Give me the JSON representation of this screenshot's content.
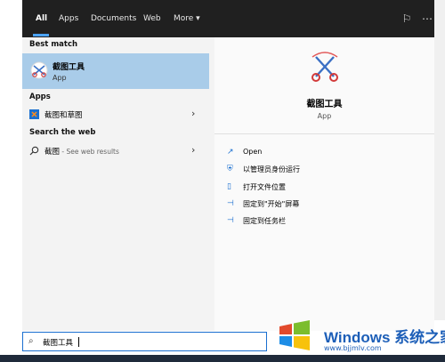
{
  "header": {
    "tabs": [
      {
        "label": "All",
        "active": true
      },
      {
        "label": "Apps",
        "active": false
      },
      {
        "label": "Documents",
        "active": false
      },
      {
        "label": "Web",
        "active": false
      },
      {
        "label": "More ▾",
        "active": false
      }
    ],
    "feedback_icon": "feedback-icon",
    "more_icon": "ellipsis-icon"
  },
  "left": {
    "best_match_title": "Best match",
    "best_match": {
      "name": "截图工具",
      "type": "App",
      "icon": "snipping-tool-icon"
    },
    "apps_title": "Apps",
    "apps": [
      {
        "label": "截图和草图",
        "icon": "snip-sketch-icon"
      }
    ],
    "web_title": "Search the web",
    "web": [
      {
        "label": "截图",
        "suffix": " - See web results",
        "icon": "search-icon"
      }
    ]
  },
  "right": {
    "app_name": "截图工具",
    "app_type": "App",
    "actions": [
      {
        "label": "Open",
        "icon": "open-icon"
      },
      {
        "label": "以管理员身份运行",
        "icon": "run-as-admin-icon"
      },
      {
        "label": "打开文件位置",
        "icon": "file-location-icon"
      },
      {
        "label": "固定到\"开始\"屏幕",
        "icon": "pin-icon"
      },
      {
        "label": "固定到任务栏",
        "icon": "pin-icon"
      }
    ]
  },
  "search": {
    "value": "截图工具",
    "icon": "search-icon"
  },
  "watermark": {
    "title": "Windows 系统之家",
    "url": "www.bjjmlv.com"
  },
  "colors": {
    "accent": "#1a6fd0",
    "selected": "#a9cce9",
    "topbar": "#202020",
    "watermark": "#1d5fb8"
  }
}
